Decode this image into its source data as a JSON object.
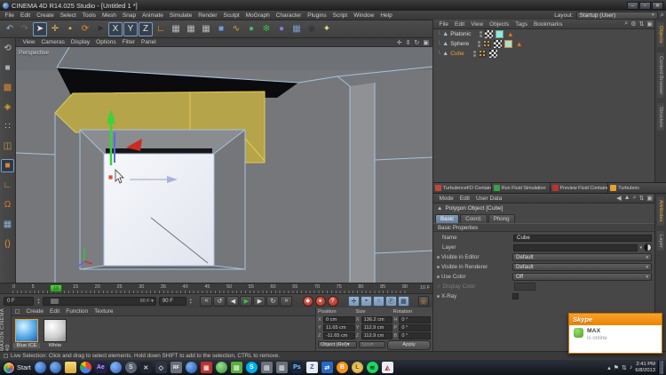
{
  "window": {
    "title": "CINEMA 4D R14.025 Studio - [Untitled 1 *]",
    "minimize": "–",
    "maximize": "▫",
    "close": "✕"
  },
  "menu_bar": {
    "items": [
      "File",
      "Edit",
      "Create",
      "Select",
      "Tools",
      "Mesh",
      "Snap",
      "Animate",
      "Simulate",
      "Render",
      "Sculpt",
      "MoGraph",
      "Character",
      "Plugins",
      "Script",
      "Window",
      "Help"
    ],
    "layout_label": "Layout:",
    "layout_value": "Startup (User)"
  },
  "toolbar": {
    "icons": [
      {
        "name": "undo-icon",
        "glyph": "↶",
        "color": "#8fb0d8"
      },
      {
        "name": "redo-icon",
        "glyph": "↷",
        "color": "#6a6a6a"
      },
      {
        "name": "live-selection-tool",
        "glyph": "➤",
        "color": "#e8e8e8",
        "boxed": true
      },
      {
        "name": "move-tool",
        "glyph": "✛",
        "color": "#e8c050"
      },
      {
        "name": "scale-tool",
        "glyph": "▪",
        "color": "#e8c23c"
      },
      {
        "name": "rotate-tool",
        "glyph": "⟳",
        "color": "#e88830"
      },
      {
        "name": "last-tool",
        "glyph": "➤",
        "color": "#2a2a2a"
      },
      {
        "name": "axis-x-toggle",
        "glyph": "X",
        "color": "#e0e0e0",
        "boxed": true
      },
      {
        "name": "axis-y-toggle",
        "glyph": "Y",
        "color": "#e0e0e0",
        "boxed": true
      },
      {
        "name": "axis-z-toggle",
        "glyph": "Z",
        "color": "#e0e0e0",
        "boxed": true
      },
      {
        "name": "coordinate-system-icon",
        "glyph": "∟",
        "color": "#e8a030"
      },
      {
        "name": "render-view-button",
        "glyph": "▦",
        "color": "#b8b8b8"
      },
      {
        "name": "render-picture-viewer-button",
        "glyph": "▦",
        "color": "#b8b8b8"
      },
      {
        "name": "render-settings-button",
        "glyph": "▦",
        "color": "#b8b8b8"
      },
      {
        "name": "add-primitive-cube-button",
        "glyph": "■",
        "color": "#6aa0dc"
      },
      {
        "name": "add-spline-button",
        "glyph": "∿",
        "color": "#e8a030"
      },
      {
        "name": "add-generator-button",
        "glyph": "●",
        "color": "#4ab86a"
      },
      {
        "name": "add-deformer-button",
        "glyph": "✻",
        "color": "#3cb04a"
      },
      {
        "name": "add-environment-button",
        "glyph": "●",
        "color": "#8a7ae0"
      },
      {
        "name": "add-floor-button",
        "glyph": "▦",
        "color": "#7a9ad0"
      },
      {
        "name": "add-camera-button",
        "glyph": "◉",
        "color": "#33353a"
      },
      {
        "name": "add-light-button",
        "glyph": "✦",
        "color": "#e8dc80"
      }
    ]
  },
  "left_toolbar": {
    "icons": [
      {
        "name": "make-editable-icon",
        "glyph": "⟲",
        "color": "#c0c0c0"
      },
      {
        "name": "model-mode-icon",
        "glyph": "■",
        "color": "#a8adb4"
      },
      {
        "name": "texture-mode-icon",
        "glyph": "▩",
        "color": "#d88830"
      },
      {
        "name": "uv-mode-icon",
        "glyph": "◈",
        "color": "#d8a030"
      },
      {
        "name": "points-mode-icon",
        "glyph": "∷",
        "color": "#c8c8c8"
      },
      {
        "name": "edges-mode-icon",
        "glyph": "◫",
        "color": "#c8a040"
      },
      {
        "name": "polygons-mode-icon",
        "glyph": "■",
        "color": "#e08828",
        "active": true
      },
      {
        "name": "axis-mode-icon",
        "glyph": "∟",
        "color": "#e09030"
      },
      {
        "name": "snap-icon",
        "glyph": "Ω",
        "color": "#e07828"
      },
      {
        "name": "workplane-icon",
        "glyph": "▦",
        "color": "#8ab0d8"
      },
      {
        "name": "workplane-lock-icon",
        "glyph": "()",
        "color": "#e09030"
      }
    ]
  },
  "viewport": {
    "menu": [
      "View",
      "Cameras",
      "Display",
      "Options",
      "Filter",
      "Panel"
    ],
    "camera_label": "Perspective",
    "view_icons": [
      {
        "name": "view-pan-icon",
        "glyph": "✛"
      },
      {
        "name": "view-dolly-icon",
        "glyph": "⇕"
      },
      {
        "name": "view-rotate-icon",
        "glyph": "↻"
      },
      {
        "name": "view-toggle-icon",
        "glyph": "▣"
      }
    ]
  },
  "object_manager": {
    "menu": [
      "File",
      "Edit",
      "View",
      "Objects",
      "Tags",
      "Bookmarks"
    ],
    "right_icons": [
      {
        "name": "om-search-icon",
        "glyph": "⌕"
      },
      {
        "name": "om-filter-icon",
        "glyph": "⚙"
      },
      {
        "name": "om-sort-icon",
        "glyph": "⇅"
      },
      {
        "name": "om-panel-icon",
        "glyph": "▣"
      }
    ],
    "objects": [
      {
        "name": "Platonic"
      },
      {
        "name": "Sphere"
      },
      {
        "name": "Cube",
        "selected": true
      }
    ],
    "side_tabs": [
      "Objects",
      "Content Browser",
      "Structure"
    ]
  },
  "plugin_bar": {
    "buttons": [
      {
        "label": "TurbulenceFD Container",
        "color": "#c04838"
      },
      {
        "label": "Run Fluid Simulation",
        "color": "#3aa048"
      },
      {
        "label": "Preview Fluid Container",
        "color": "#c03030"
      },
      {
        "label": "Turbulenc",
        "color": "#e8a030"
      }
    ]
  },
  "attribute_manager": {
    "menu": [
      "Mode",
      "Edit",
      "User Data"
    ],
    "right_icons": [
      {
        "name": "am-back-icon",
        "glyph": "◀"
      },
      {
        "name": "am-up-icon",
        "glyph": "▲"
      },
      {
        "name": "am-search-icon",
        "glyph": "⌕"
      },
      {
        "name": "am-sort-icon",
        "glyph": "⇅"
      },
      {
        "name": "am-panel-icon",
        "glyph": "▣"
      }
    ],
    "object_title": "Polygon Object [Cube]",
    "tabs": [
      "Basic",
      "Coord.",
      "Phong"
    ],
    "active_tab": "Basic",
    "section": "Basic Properties",
    "fields": [
      {
        "label": "Name",
        "value": "Cube"
      },
      {
        "label": "Layer",
        "value": ""
      },
      {
        "label": "Visible in Editor",
        "value": "Default"
      },
      {
        "label": "Visible in Renderer",
        "value": "Default"
      },
      {
        "label": "Use Color",
        "value": "Off"
      },
      {
        "label": "Display Color",
        "value": ""
      },
      {
        "label": "X-Ray",
        "value": ""
      }
    ],
    "side_tabs": [
      "Attributes",
      "Layer"
    ]
  },
  "timeline": {
    "ticks": [
      "0",
      "5",
      "10",
      "15",
      "20",
      "25",
      "30",
      "35",
      "40",
      "45",
      "50",
      "55",
      "60",
      "65",
      "70",
      "75",
      "80",
      "85",
      "90"
    ],
    "end_label": "10 F",
    "current_frame": "10"
  },
  "transport": {
    "start_value": "0 F",
    "slider_end_label": "90 F",
    "end_value": "90 F",
    "playback": [
      {
        "name": "goto-start-button",
        "glyph": "«",
        "color": "#ddd"
      },
      {
        "name": "goto-prev-key-button",
        "glyph": "↺",
        "color": "#ddd"
      },
      {
        "name": "prev-frame-button",
        "glyph": "◀",
        "color": "#ddd"
      },
      {
        "name": "play-button",
        "glyph": "▶",
        "color": "#3fc040"
      },
      {
        "name": "next-frame-button",
        "glyph": "▶",
        "color": "#ddd"
      },
      {
        "name": "goto-next-key-button",
        "glyph": "↻",
        "color": "#ddd"
      },
      {
        "name": "goto-end-button",
        "glyph": "»",
        "color": "#ddd"
      }
    ],
    "record": [
      {
        "name": "record-keyframe-button",
        "glyph": "◆"
      },
      {
        "name": "autokey-button",
        "glyph": "●"
      },
      {
        "name": "keyframe-selection-button",
        "glyph": "?"
      }
    ],
    "toggles": [
      {
        "name": "key-position-toggle",
        "glyph": "✛"
      },
      {
        "name": "key-scale-toggle",
        "glyph": "▪"
      },
      {
        "name": "key-rotation-toggle",
        "glyph": "○"
      },
      {
        "name": "key-parameter-toggle",
        "glyph": "Ⓟ"
      },
      {
        "name": "key-pla-toggle",
        "glyph": "▦"
      }
    ],
    "solo_glyph": "◎"
  },
  "materials": {
    "menu": [
      "Create",
      "Edit",
      "Function",
      "Texture"
    ],
    "items": [
      {
        "name": "Blue ICE",
        "selected": true
      },
      {
        "name": "White"
      }
    ],
    "brand": "MAXON  CINEMA 4D"
  },
  "coordinates": {
    "columns": [
      {
        "header": "Position",
        "rows": [
          [
            "X",
            "0 cm"
          ],
          [
            "Y",
            "11.65 cm"
          ],
          [
            "Z",
            "-11.65 cm"
          ]
        ]
      },
      {
        "header": "Size",
        "rows": [
          [
            "X",
            "136.2 cm"
          ],
          [
            "Y",
            "112.9 cm"
          ],
          [
            "Z",
            "112.9 cm"
          ]
        ]
      },
      {
        "header": "Rotation",
        "rows": [
          [
            "H",
            "0 °"
          ],
          [
            "P",
            "0 °"
          ],
          [
            "B",
            "0 °"
          ]
        ]
      }
    ],
    "mode": "Object (Rel)",
    "size_label": "Size",
    "apply": "Apply"
  },
  "status_bar": {
    "text": "Live Selection: Click and drag to select elements. Hold down SHIFT to add to the selection, CTRL to remove."
  },
  "skype": {
    "app": "Skype",
    "contact": "MAX",
    "status": "is online"
  },
  "taskbar": {
    "start": "Start",
    "icons": [
      {
        "name": "taskbar-cinema4d-icon",
        "glyph": "",
        "style": "background:radial-gradient(circle at 35% 35%,#7db2f0,#1d4fa8)",
        "round": true
      },
      {
        "name": "taskbar-cinema4d-icon-2",
        "glyph": "",
        "style": "background:radial-gradient(circle at 35% 35%,#7db2f0,#1d4fa8)",
        "round": true
      },
      {
        "name": "taskbar-folder-icon",
        "glyph": "",
        "style": "background:linear-gradient(#f5d87a,#d8a93c)"
      },
      {
        "name": "taskbar-chrome-icon",
        "glyph": "",
        "style": "background:conic-gradient(#ea4335 0 33%,#4285f4 33% 66%,#34a853 66% 85%,#fbbc05 85% 100%)",
        "round": true
      },
      {
        "name": "taskbar-after-effects-icon",
        "glyph": "Ae",
        "style": "background:#25204a;color:#b0a4f5"
      },
      {
        "name": "taskbar-blue-sphere-icon",
        "glyph": "",
        "style": "background:radial-gradient(circle at 35% 35%,#86b8f5,#2a5cb8)",
        "round": true
      },
      {
        "name": "taskbar-gray-app-icon",
        "glyph": "S",
        "style": "background:#5a6472;color:#d8dde5",
        "round": true
      },
      {
        "name": "taskbar-3dsmax-icon",
        "glyph": "✕",
        "style": "background:#20242c;color:#cfd6e4"
      },
      {
        "name": "taskbar-unity-icon",
        "glyph": "◇",
        "style": "background:#2e3440;color:#dfe6f0"
      },
      {
        "name": "taskbar-realflow-icon",
        "glyph": "RF",
        "style": "background:#6a7078;color:#fff;font-size:5px"
      },
      {
        "name": "taskbar-cinema4d-icon-3",
        "glyph": "",
        "style": "background:radial-gradient(circle at 35% 35%,#7db2f0,#1d4fa8)",
        "round": true
      },
      {
        "name": "taskbar-red-app-icon",
        "glyph": "▣",
        "style": "background:#b8342e;color:#f5d0d0"
      },
      {
        "name": "taskbar-green-globe-icon",
        "glyph": "",
        "style": "background:radial-gradient(circle at 40% 35%,#9fe08a,#2e8f3a)",
        "round": true
      },
      {
        "name": "taskbar-green-map-icon",
        "glyph": "▤",
        "style": "background:#5cae3c;color:#eaf5df"
      },
      {
        "name": "taskbar-skype-icon",
        "glyph": "S",
        "style": "background:#00aff0;color:#fff",
        "round": true
      },
      {
        "name": "taskbar-drive-icon",
        "glyph": "▤",
        "style": "background:#6a7078;color:#d8dde5"
      },
      {
        "name": "taskbar-devices-icon",
        "glyph": "▥",
        "style": "background:#6a7078;color:#d8dde5"
      },
      {
        "name": "taskbar-photoshop-icon",
        "glyph": "Ps",
        "style": "background:#14263c;color:#8ec6f5"
      },
      {
        "name": "taskbar-z-app-icon",
        "glyph": "Z",
        "style": "background:#e8ecf2;color:#2a58b8"
      },
      {
        "name": "taskbar-teamviewer-icon",
        "glyph": "⇄",
        "style": "background:#2569c3;color:#fff"
      },
      {
        "name": "taskbar-bitcoin-icon",
        "glyph": "B",
        "style": "background:#f7931a;color:#fff",
        "round": true
      },
      {
        "name": "taskbar-coin-icon",
        "glyph": "Ł",
        "style": "background:radial-gradient(#f5d87a,#c89a2e);color:#7a5c10",
        "round": true
      },
      {
        "name": "taskbar-spotify-icon",
        "glyph": "≋",
        "style": "background:#1ed760;color:#0e3818",
        "round": true
      },
      {
        "name": "taskbar-photos-icon",
        "glyph": "◭",
        "style": "background:#e8eef5;color:#c23a3a"
      }
    ],
    "tray_icons": [
      {
        "name": "tray-expand-icon",
        "glyph": "▴"
      },
      {
        "name": "tray-flag-icon",
        "glyph": "⚑"
      },
      {
        "name": "tray-network-icon",
        "glyph": "⇅"
      },
      {
        "name": "tray-volume-icon",
        "glyph": "♪"
      }
    ],
    "time": "2:41 PM",
    "date": "6/8/2013"
  },
  "colors": {
    "accent_orange": "#e8a33d",
    "selection_yellow": "#b5a44a",
    "wireframe_blue": "#a6c3de",
    "record_red": "#b84040",
    "toggle_blue": "#8aa4c0",
    "skype_orange": "#ee8200",
    "play_green": "#3fc040"
  }
}
